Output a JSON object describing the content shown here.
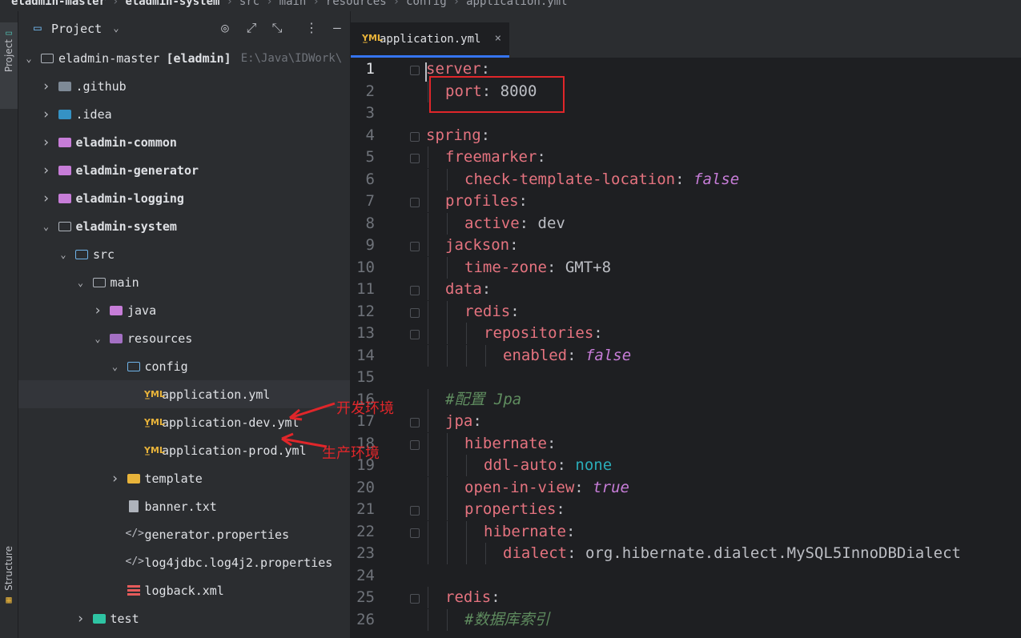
{
  "breadcrumb": [
    "eladmin-master",
    "eladmin-system",
    "src",
    "main",
    "resources",
    "config",
    "application.yml"
  ],
  "toolstrip": {
    "project_tab": "Project",
    "structure_tab": "Structure"
  },
  "project_panel": {
    "title": "Project",
    "tree": [
      {
        "label": "eladmin-master",
        "extra_bold": "[eladmin]",
        "extra": "E:\\Java\\IDWork\\",
        "indent": 0,
        "chev": "down",
        "icon": "folder-outline"
      },
      {
        "label": ".github",
        "indent": 1,
        "chev": "right",
        "icon": "folder-github"
      },
      {
        "label": ".idea",
        "indent": 1,
        "chev": "right",
        "icon": "folder-blue"
      },
      {
        "label": "eladmin-common",
        "indent": 1,
        "chev": "right",
        "icon": "folder-module",
        "bold": true
      },
      {
        "label": "eladmin-generator",
        "indent": 1,
        "chev": "right",
        "icon": "folder-module",
        "bold": true
      },
      {
        "label": "eladmin-logging",
        "indent": 1,
        "chev": "right",
        "icon": "folder-module",
        "bold": true
      },
      {
        "label": "eladmin-system",
        "indent": 1,
        "chev": "down",
        "icon": "folder-outline",
        "bold": true
      },
      {
        "label": "src",
        "indent": 2,
        "chev": "down",
        "icon": "folder-src"
      },
      {
        "label": "main",
        "indent": 3,
        "chev": "down",
        "icon": "folder-outline"
      },
      {
        "label": "java",
        "indent": 4,
        "chev": "right",
        "icon": "folder-module"
      },
      {
        "label": "resources",
        "indent": 4,
        "chev": "down",
        "icon": "folder-resources"
      },
      {
        "label": "config",
        "indent": 5,
        "chev": "down",
        "icon": "folder-config"
      },
      {
        "label": "application.yml",
        "indent": 6,
        "chev": "",
        "icon": "yml",
        "selected": true
      },
      {
        "label": "application-dev.yml",
        "indent": 6,
        "chev": "",
        "icon": "yml"
      },
      {
        "label": "application-prod.yml",
        "indent": 6,
        "chev": "",
        "icon": "yml"
      },
      {
        "label": "template",
        "indent": 5,
        "chev": "right",
        "icon": "folder-yellow"
      },
      {
        "label": "banner.txt",
        "indent": 5,
        "chev": "",
        "icon": "txt"
      },
      {
        "label": "generator.properties",
        "indent": 5,
        "chev": "",
        "icon": "properties"
      },
      {
        "label": "log4jdbc.log4j2.properties",
        "indent": 5,
        "chev": "",
        "icon": "properties"
      },
      {
        "label": "logback.xml",
        "indent": 5,
        "chev": "",
        "icon": "xml"
      },
      {
        "label": "test",
        "indent": 3,
        "chev": "right",
        "icon": "folder-teal"
      }
    ]
  },
  "editor": {
    "tab_label": "application.yml",
    "tab_icon_text": "Y̲ML",
    "lines": [
      {
        "n": "1",
        "indent": 0,
        "key": "server",
        "value": "",
        "vtype": ""
      },
      {
        "n": "2",
        "indent": 1,
        "key": "port",
        "value": "8000",
        "vtype": "v"
      },
      {
        "n": "3",
        "indent": 0,
        "key": "",
        "value": "",
        "vtype": ""
      },
      {
        "n": "4",
        "indent": 0,
        "key": "spring",
        "value": "",
        "vtype": ""
      },
      {
        "n": "5",
        "indent": 1,
        "key": "freemarker",
        "value": "",
        "vtype": ""
      },
      {
        "n": "6",
        "indent": 2,
        "key": "check-template-location",
        "value": "false",
        "vtype": "kw"
      },
      {
        "n": "7",
        "indent": 1,
        "key": "profiles",
        "value": "",
        "vtype": ""
      },
      {
        "n": "8",
        "indent": 2,
        "key": "active",
        "value": "dev",
        "vtype": "v"
      },
      {
        "n": "9",
        "indent": 1,
        "key": "jackson",
        "value": "",
        "vtype": ""
      },
      {
        "n": "10",
        "indent": 2,
        "key": "time-zone",
        "value": "GMT+8",
        "vtype": "v"
      },
      {
        "n": "11",
        "indent": 1,
        "key": "data",
        "value": "",
        "vtype": ""
      },
      {
        "n": "12",
        "indent": 2,
        "key": "redis",
        "value": "",
        "vtype": ""
      },
      {
        "n": "13",
        "indent": 3,
        "key": "repositories",
        "value": "",
        "vtype": ""
      },
      {
        "n": "14",
        "indent": 4,
        "key": "enabled",
        "value": "false",
        "vtype": "kw"
      },
      {
        "n": "15",
        "indent": 0,
        "key": "",
        "value": "",
        "vtype": ""
      },
      {
        "n": "16",
        "indent": 1,
        "comment": "#配置 Jpa"
      },
      {
        "n": "17",
        "indent": 1,
        "key": "jpa",
        "value": "",
        "vtype": ""
      },
      {
        "n": "18",
        "indent": 2,
        "key": "hibernate",
        "value": "",
        "vtype": ""
      },
      {
        "n": "19",
        "indent": 3,
        "key": "ddl-auto",
        "value": "none",
        "vtype": "num"
      },
      {
        "n": "20",
        "indent": 2,
        "key": "open-in-view",
        "value": "true",
        "vtype": "kw"
      },
      {
        "n": "21",
        "indent": 2,
        "key": "properties",
        "value": "",
        "vtype": ""
      },
      {
        "n": "22",
        "indent": 3,
        "key": "hibernate",
        "value": "",
        "vtype": ""
      },
      {
        "n": "23",
        "indent": 4,
        "key": "dialect",
        "value": "org.hibernate.dialect.MySQL5InnoDBDialect",
        "vtype": "v"
      },
      {
        "n": "24",
        "indent": 0,
        "key": "",
        "value": "",
        "vtype": ""
      },
      {
        "n": "25",
        "indent": 1,
        "key": "redis",
        "value": "",
        "vtype": ""
      },
      {
        "n": "26",
        "indent": 2,
        "comment": "#数据库索引"
      }
    ]
  },
  "annotations": {
    "dev_label": "开发环境",
    "prod_label": "生产环境"
  },
  "colors": {
    "accent": "#3574f0",
    "annotation_red": "#e0262a"
  }
}
